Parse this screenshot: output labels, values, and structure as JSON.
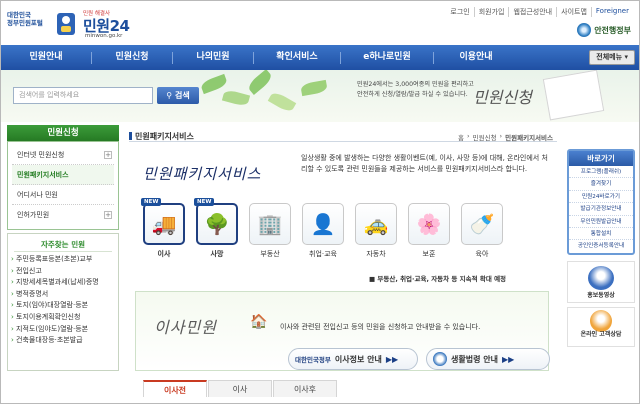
{
  "header": {
    "logo_line1": "대한민국",
    "logo_line2": "정부민원포털",
    "logo_kicker": "민원 해결사",
    "logo_text": "민원24",
    "logo_url": "minwon.go.kr",
    "util_links": [
      "로그인",
      "회원가입",
      "웹접근성안내",
      "사이트맵",
      "Foreigner"
    ],
    "gov_label": "안전행정부"
  },
  "nav": {
    "items": [
      "민원안내",
      "민원신청",
      "나의민원",
      "확인서비스",
      "e하나로민원",
      "이용안내"
    ],
    "all_menu": "전체메뉴 ▾"
  },
  "band": {
    "search_placeholder": "검색어를 입력하세요",
    "search_button": "검색",
    "text": "민원24에서는 3,000여종의 민원을 편리하고 안전하게 신청/열람/발급 하실 수 있습니다.",
    "title": "민원신청"
  },
  "lnav": {
    "title": "민원신청",
    "items": [
      {
        "label": "인터넷 민원신청",
        "plus": "+"
      },
      {
        "label": "민원패키지서비스",
        "plus": ""
      },
      {
        "label": "어디서나 민원",
        "plus": ""
      },
      {
        "label": "인허가민원",
        "plus": "+"
      }
    ]
  },
  "freq": {
    "title": "자주찾는 민원",
    "items": [
      "주민등록표등본(초본)교부",
      "전입신고",
      "지방세세목별과세(납세)증명",
      "병적증명서",
      "토지(임야)대장열람·등본",
      "토지이용계획확인신청",
      "지적도(임야도)열람·등본",
      "건축물대장등·초본발급"
    ]
  },
  "main": {
    "page_title": "민원패키지서비스",
    "crumbs": [
      "홈",
      "›",
      "민원신청",
      "›",
      "민원패키지서비스"
    ],
    "pkg_title": "민원패키지서비스",
    "pkg_desc": "일상생활 중에 발생하는 다양한 생활이벤트(예, 이사, 사망 등)에 대해, 온라인에서 처리할 수 있도록 관련 민원들을 제공하는 서비스를 민원패키지서비스라 합니다.",
    "icons": [
      {
        "label": "이사",
        "new": "NEW",
        "glyph": "🚚"
      },
      {
        "label": "사망",
        "new": "NEW",
        "glyph": "🌳"
      },
      {
        "label": "부동산",
        "new": "",
        "glyph": "🏢"
      },
      {
        "label": "취업·교육",
        "new": "",
        "glyph": "👤"
      },
      {
        "label": "자동차",
        "new": "",
        "glyph": "🚕"
      },
      {
        "label": "보훈",
        "new": "",
        "glyph": "🌸"
      },
      {
        "label": "육아",
        "new": "",
        "glyph": "🍼"
      }
    ],
    "extend_note": "■ 부동산, 취업·교육, 자동차 등 지속적 확대 예정",
    "move_title": "이사민원",
    "move_desc": "이사와 관련된 전입신고 등의 민원을 신청하고 안내받을 수 있습니다.",
    "btn1_gov": "대한민국정부",
    "btn1_text": "이사정보 안내",
    "btn1_arrow": "▶▶",
    "btn2_text": "생활법령 안내",
    "btn2_arrow": "▶▶",
    "tabs": [
      "이사전",
      "이사",
      "이사후"
    ]
  },
  "rcol": {
    "quick_title": "바로가기",
    "quick_items": [
      "프로그램(플래쉬)",
      "즐겨찾기",
      "민원24바로가기",
      "발급기관정보안내",
      "무인민원발급안내",
      "통합설치",
      "공인인증서등록안내"
    ],
    "promo_caption": "홍보동영상",
    "promo2_caption": "온라인 고객상담"
  },
  "colors": {
    "nav_blue": "#1f4fa3",
    "green": "#267a24",
    "tab_red": "#c93a21"
  }
}
